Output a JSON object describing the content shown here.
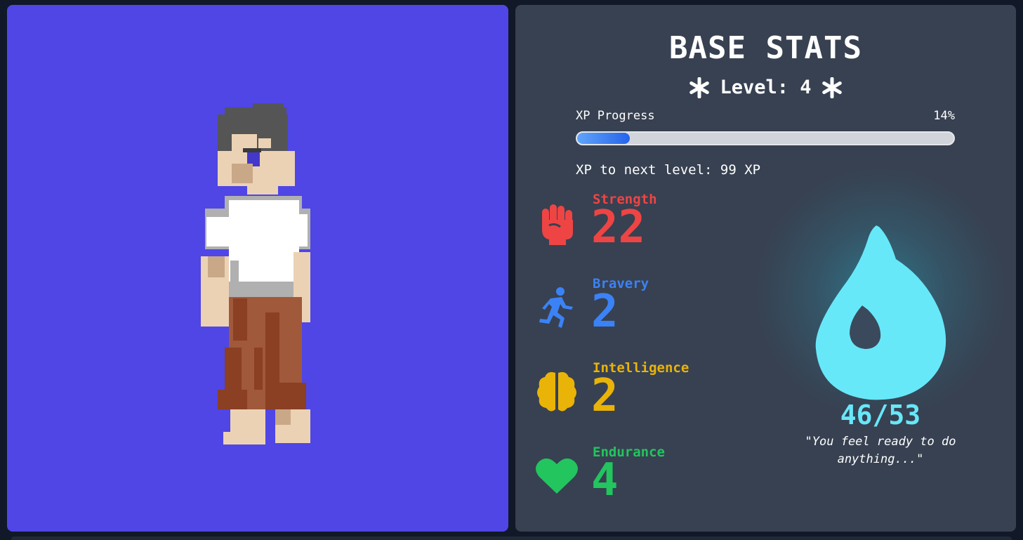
{
  "stats_panel": {
    "title": "BASE STATS",
    "level_text": "Level: 4",
    "xp": {
      "label": "XP Progress",
      "percent_text": "14%",
      "progress_fraction": 0.14,
      "next_level_text": "XP to next level: 99 XP"
    },
    "stats": [
      {
        "name": "Strength",
        "value": "22",
        "color": "#ef4444",
        "icon": "fist-icon"
      },
      {
        "name": "Bravery",
        "value": "2",
        "color": "#3b82f6",
        "icon": "running-person-icon"
      },
      {
        "name": "Intelligence",
        "value": "2",
        "color": "#eab308",
        "icon": "brain-icon"
      },
      {
        "name": "Endurance",
        "value": "4",
        "color": "#22c55e",
        "icon": "heart-icon"
      }
    ],
    "energy": {
      "value_text": "46/53",
      "quote": "\"You feel ready to do anything...\"",
      "color": "#67e8f9",
      "icon": "flame-icon"
    }
  },
  "character_panel": {
    "background_color": "#4f46e5",
    "avatar_icon": "pixel-character"
  }
}
